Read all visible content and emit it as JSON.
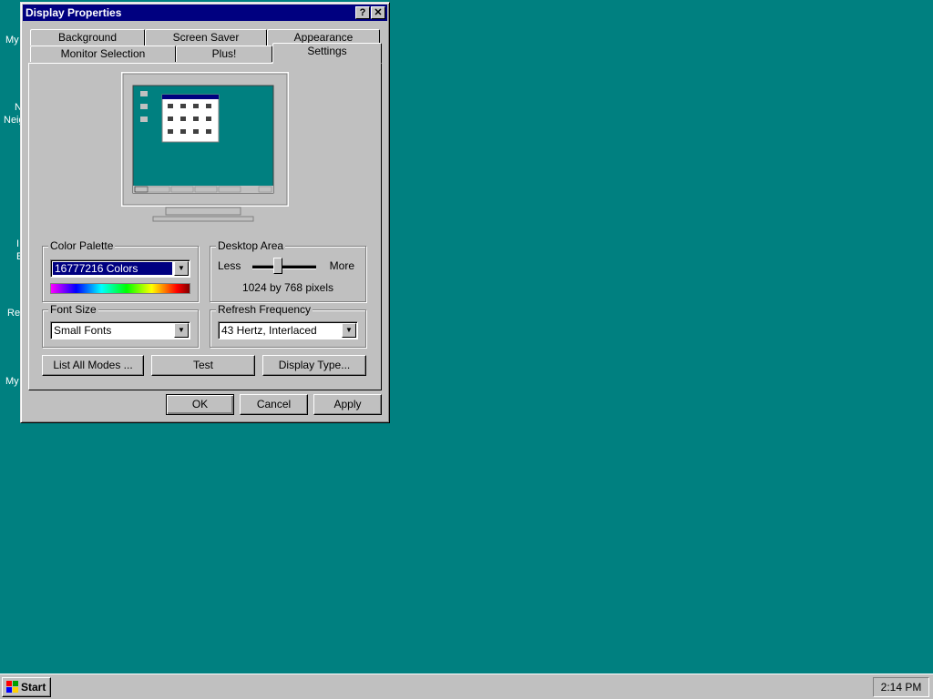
{
  "desktop": {
    "labels": [
      "My",
      "N",
      "Neig",
      "I",
      "E",
      "Re",
      "My"
    ]
  },
  "window": {
    "title": "Display Properties",
    "help_glyph": "?",
    "close_glyph": "✕"
  },
  "tabs": {
    "row1": [
      "Background",
      "Screen Saver",
      "Appearance"
    ],
    "row2": [
      "Monitor Selection",
      "Plus!",
      "Settings"
    ],
    "active": "Settings"
  },
  "color_palette": {
    "label": "Color Palette",
    "value": "16777216 Colors"
  },
  "desktop_area": {
    "label": "Desktop Area",
    "less": "Less",
    "more": "More",
    "value_text": "1024 by 768 pixels",
    "slider_level": 0.4
  },
  "font_size": {
    "label": "Font Size",
    "value": "Small Fonts"
  },
  "refresh": {
    "label": "Refresh Frequency",
    "value": "43 Hertz, Interlaced"
  },
  "buttons": {
    "list_modes": "List All Modes ...",
    "test": "Test",
    "display_type": "Display Type...",
    "ok": "OK",
    "cancel": "Cancel",
    "apply": "Apply"
  },
  "taskbar": {
    "start": "Start",
    "clock": "2:14 PM"
  },
  "colors": {
    "desktop": "#008080",
    "titlebar": "#000080",
    "face": "#c0c0c0"
  }
}
